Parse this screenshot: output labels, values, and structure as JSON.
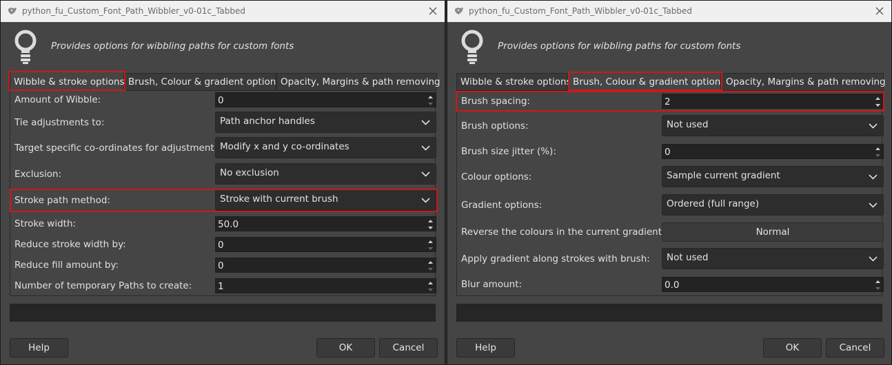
{
  "left": {
    "title": "python_fu_Custom_Font_Path_Wibbler_v0-01c_Tabbed",
    "description": "Provides options for wibbling paths for custom fonts",
    "tabs": [
      "Wibble & stroke options",
      "Brush, Colour & gradient options",
      "Opacity, Margins & path removing"
    ],
    "active_tab": 0,
    "rows": [
      {
        "label": "Amount of Wibble:",
        "type": "spin",
        "value": "0"
      },
      {
        "label": "Tie adjustments to:",
        "type": "combo",
        "value": "Path anchor handles"
      },
      {
        "label": "Target specific co-ordinates for adjustment:",
        "type": "combo",
        "value": "Modify x and y co-ordinates"
      },
      {
        "label": "Exclusion:",
        "type": "combo",
        "value": "No exclusion"
      },
      {
        "label": "Stroke path method:",
        "type": "combo",
        "value": "Stroke with current brush"
      },
      {
        "label": "Stroke width:",
        "type": "spin",
        "value": "50.0"
      },
      {
        "label": "Reduce stroke width by:",
        "type": "spin",
        "value": "0"
      },
      {
        "label": "Reduce fill amount by:",
        "type": "spin",
        "value": "0"
      },
      {
        "label": "Number of temporary Paths to create:",
        "type": "spin",
        "value": "1"
      }
    ],
    "buttons": {
      "help": "Help",
      "ok": "OK",
      "cancel": "Cancel"
    }
  },
  "right": {
    "title": "python_fu_Custom_Font_Path_Wibbler_v0-01c_Tabbed",
    "description": "Provides options for wibbling paths for custom fonts",
    "tabs": [
      "Wibble & stroke options",
      "Brush, Colour & gradient options",
      "Opacity, Margins & path removing"
    ],
    "active_tab": 1,
    "rows": [
      {
        "label": "Brush spacing:",
        "type": "spin",
        "value": "2"
      },
      {
        "label": "Brush options:",
        "type": "combo",
        "value": "Not used"
      },
      {
        "label": "Brush size jitter (%):",
        "type": "spin",
        "value": "0"
      },
      {
        "label": "Colour options:",
        "type": "combo",
        "value": "Sample current gradient"
      },
      {
        "label": "Gradient options:",
        "type": "combo",
        "value": "Ordered (full range)"
      },
      {
        "label": "Reverse the colours in the current gradient:",
        "type": "button",
        "value": "Normal"
      },
      {
        "label": "Apply gradient along strokes with brush:",
        "type": "combo",
        "value": "Not used"
      },
      {
        "label": "Blur amount:",
        "type": "spin",
        "value": "0.0"
      }
    ],
    "buttons": {
      "help": "Help",
      "ok": "OK",
      "cancel": "Cancel"
    }
  },
  "colors": {
    "highlight": "#d01818",
    "dialog_bg": "#454545",
    "titlebar_bg": "#f0f0f0"
  }
}
